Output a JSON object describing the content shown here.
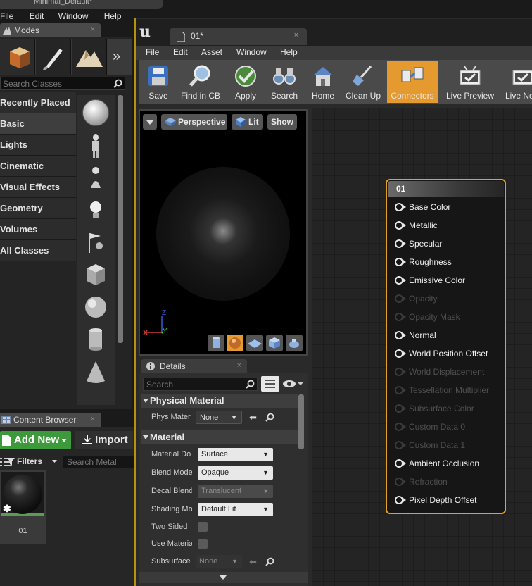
{
  "main_window": {
    "title": "Minimal_Default*",
    "menu": [
      "File",
      "Edit",
      "Window",
      "Help"
    ]
  },
  "modes": {
    "tab_label": "Modes",
    "close": "×",
    "search_placeholder": "Search Classes",
    "categories": [
      "Recently Placed",
      "Basic",
      "Lights",
      "Cinematic",
      "Visual Effects",
      "Geometry",
      "Volumes",
      "All Classes"
    ],
    "selected_category": "Basic",
    "more_glyph": "»"
  },
  "content_browser": {
    "tab_label": "Content Browser",
    "close": "×",
    "add_new": "Add New",
    "import": "Import",
    "filters": "Filters",
    "search_placeholder": "Search Metal",
    "asset_name": "01"
  },
  "editor": {
    "tab_label": "01*",
    "close": "×",
    "menu": [
      "File",
      "Edit",
      "Asset",
      "Window",
      "Help"
    ],
    "toolbar": [
      {
        "label": "Save",
        "icon": "save-icon"
      },
      {
        "label": "Find in CB",
        "icon": "magnifier-icon"
      },
      {
        "label": "Apply",
        "icon": "checkmark-icon"
      },
      {
        "label": "Search",
        "icon": "binoculars-icon"
      },
      {
        "label": "Home",
        "icon": "home-icon"
      },
      {
        "label": "Clean Up",
        "icon": "broom-icon"
      },
      {
        "label": "Connectors",
        "icon": "connectors-icon",
        "active": true
      },
      {
        "label": "Live Preview",
        "icon": "tv-icon"
      },
      {
        "label": "Live No",
        "icon": "tv-icon"
      }
    ],
    "active_color": "#e49a2e"
  },
  "viewport": {
    "perspective": "Perspective",
    "lit": "Lit",
    "show": "Show",
    "axis_z": "Z",
    "axis_y": "Y"
  },
  "details": {
    "tab_label": "Details",
    "close": "×",
    "search_placeholder": "Search",
    "sections": [
      {
        "title": "Physical Material",
        "rows": [
          {
            "label": "Phys Mater",
            "value": "None"
          }
        ]
      },
      {
        "title": "Material",
        "rows": [
          {
            "label": "Material Do",
            "value": "Surface"
          },
          {
            "label": "Blend Mode",
            "value": "Opaque"
          },
          {
            "label": "Decal Blend",
            "value": "Translucent"
          },
          {
            "label": "Shading Mo",
            "value": "Default Lit"
          },
          {
            "label": "Two Sided"
          },
          {
            "label": "Use Materia"
          },
          {
            "label": "Subsurface",
            "value": "None"
          }
        ]
      }
    ]
  },
  "node": {
    "title": "01",
    "accent": "#e8a020",
    "pins": [
      {
        "label": "Base Color",
        "enabled": true
      },
      {
        "label": "Metallic",
        "enabled": true
      },
      {
        "label": "Specular",
        "enabled": true
      },
      {
        "label": "Roughness",
        "enabled": true
      },
      {
        "label": "Emissive Color",
        "enabled": true
      },
      {
        "label": "Opacity",
        "enabled": false
      },
      {
        "label": "Opacity Mask",
        "enabled": false
      },
      {
        "label": "Normal",
        "enabled": true
      },
      {
        "label": "World Position Offset",
        "enabled": true
      },
      {
        "label": "World Displacement",
        "enabled": false
      },
      {
        "label": "Tessellation Multiplier",
        "enabled": false
      },
      {
        "label": "Subsurface Color",
        "enabled": false
      },
      {
        "label": "Custom Data 0",
        "enabled": false
      },
      {
        "label": "Custom Data 1",
        "enabled": false
      },
      {
        "label": "Ambient Occlusion",
        "enabled": true
      },
      {
        "label": "Refraction",
        "enabled": false
      },
      {
        "label": "Pixel Depth Offset",
        "enabled": true
      }
    ]
  }
}
